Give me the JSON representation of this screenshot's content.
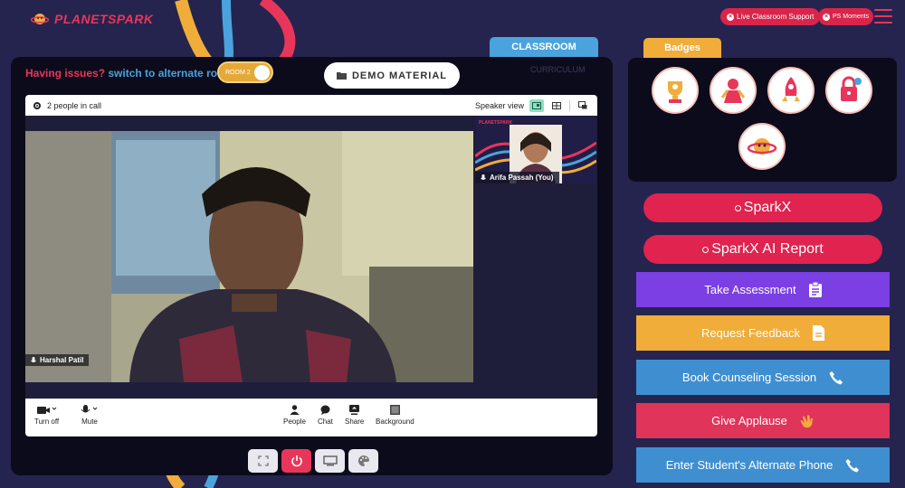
{
  "header": {
    "logo_text": "PLANETSPARK",
    "live_support_label": "Live Classroom Support",
    "ps_moments_label": "PS Moments"
  },
  "classroom": {
    "tab_classroom": "CLASSROOM",
    "tab_curriculum": "CURRICULUM",
    "issues_prefix": "Having issues?",
    "issues_link": "switch to alternate room",
    "room_toggle_label": "ROOM 2",
    "demo_material_label": "DEMO MATERIAL"
  },
  "meeting": {
    "people_count": "2 people in call",
    "view_label": "Speaker view",
    "main_participant": "Harshal Patil",
    "thumb_participant": "Arifa Passah (You)",
    "thumb_brand": "PLANETSPARK",
    "controls": {
      "turn_off": "Turn off",
      "mute": "Mute",
      "people": "People",
      "chat": "Chat",
      "share": "Share",
      "background": "Background"
    }
  },
  "badges": {
    "title": "Badges"
  },
  "actions": {
    "sparkx": "SparkX",
    "sparkx_report": "SparkX AI Report",
    "take_assessment": "Take Assessment",
    "request_feedback": "Request Feedback",
    "book_counseling": "Book Counseling Session",
    "give_applause": "Give Applause",
    "alternate_phone": "Enter Student's Alternate Phone"
  },
  "colors": {
    "background": "#25244f",
    "brand_red": "#e0234f",
    "purple": "#7b3fe4",
    "orange": "#f0ad3a",
    "blue": "#3f8fd0"
  }
}
